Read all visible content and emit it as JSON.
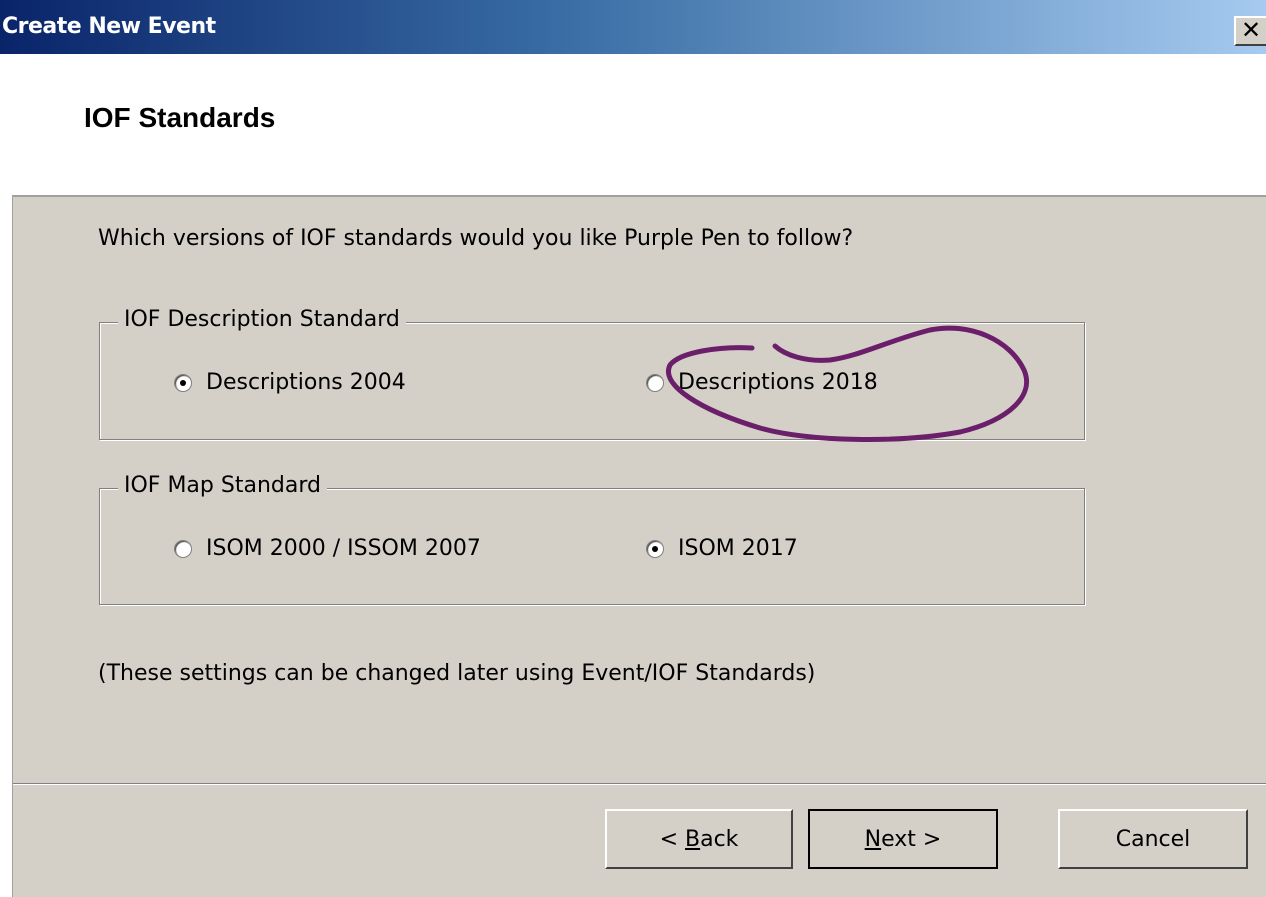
{
  "window": {
    "title": "Create New Event",
    "close_glyph": "✕",
    "close_icon": "close-icon"
  },
  "header": {
    "title": "IOF Standards"
  },
  "main": {
    "question": "Which versions of IOF standards would you like Purple Pen to follow?",
    "description_group": {
      "legend": "IOF Description Standard",
      "options": [
        {
          "label": "Descriptions 2004",
          "checked": true
        },
        {
          "label": "Descriptions 2018",
          "checked": false
        }
      ]
    },
    "map_group": {
      "legend": "IOF Map Standard",
      "options": [
        {
          "label": "ISOM 2000 / ISSOM 2007",
          "checked": false
        },
        {
          "label": "ISOM 2017",
          "checked": true
        }
      ]
    },
    "note": "(These settings can be changed later using Event/IOF Standards)"
  },
  "footer": {
    "back_prefix": "< ",
    "back_mnemonic": "B",
    "back_rest": "ack",
    "next_mnemonic": "N",
    "next_rest": "ext >",
    "cancel_label": "Cancel"
  },
  "annotation": {
    "color": "#6b1f6b"
  }
}
